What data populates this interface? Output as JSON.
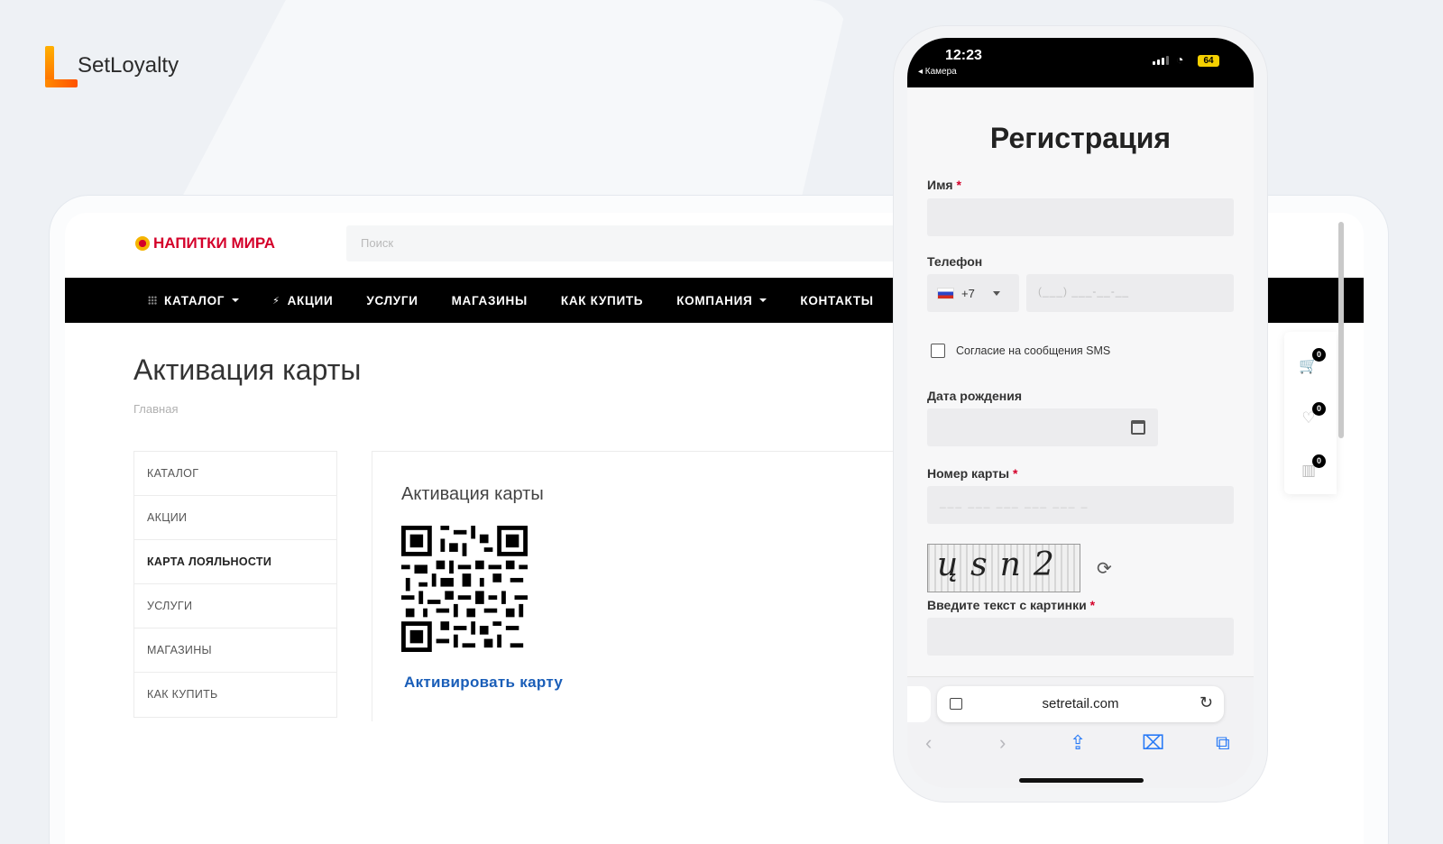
{
  "brand": {
    "name": "SetLoyalty"
  },
  "site": {
    "logo": "НАПИТКИ МИРА",
    "search_placeholder": "Поиск",
    "nav": [
      "КАТАЛОГ",
      "АКЦИИ",
      "УСЛУГИ",
      "МАГАЗИНЫ",
      "КАК КУПИТЬ",
      "КОМПАНИЯ",
      "КОНТАКТЫ"
    ],
    "page_title": "Активация карты",
    "breadcrumb": "Главная",
    "side_menu": [
      "КАТАЛОГ",
      "АКЦИИ",
      "КАРТА ЛОЯЛЬНОСТИ",
      "УСЛУГИ",
      "МАГАЗИНЫ",
      "КАК КУПИТЬ"
    ],
    "active_menu": "КАРТА ЛОЯЛЬНОСТИ",
    "content_title": "Активация карты",
    "activate_link": "Активировать карту",
    "widget": {
      "cart_count": "0",
      "favorites_count": "0",
      "compare_count": "0"
    }
  },
  "phone": {
    "status": {
      "time": "12:23",
      "back": "◂ Камера",
      "battery": "64"
    },
    "form": {
      "title": "Регистрация",
      "name_label": "Имя",
      "phone_label": "Телефон",
      "phone_code": "+7",
      "phone_mask": "(___) ___-__-__",
      "sms_consent": "Согласие на сообщения SMS",
      "birth_label": "Дата рождения",
      "card_label": "Номер карты",
      "card_mask": "___ ___ ___ ___ ___ _",
      "captcha_text": "ųsn2",
      "captcha_label": "Введите текст с картинки",
      "required_mark": "*"
    },
    "browser": {
      "url": "setretail.com"
    }
  },
  "colors": {
    "accent": "#d4002a",
    "link": "#1a5eb8",
    "brand_orange": "#ff7a00"
  }
}
